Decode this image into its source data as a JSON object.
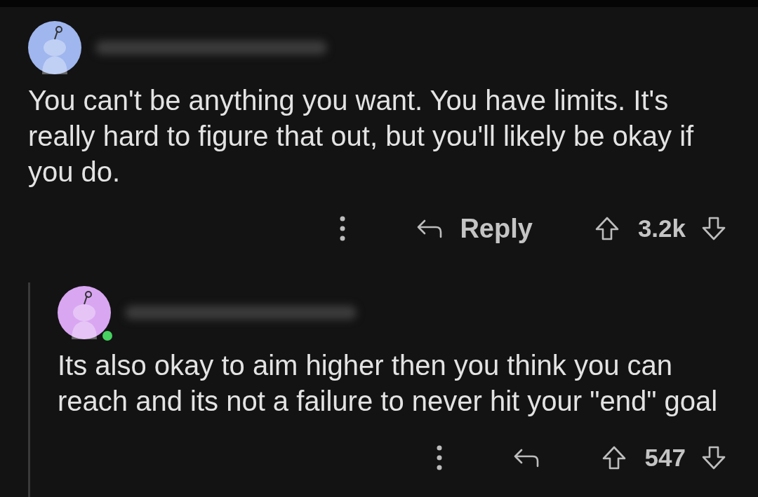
{
  "comments": [
    {
      "color": "#9fb6ee",
      "online": false,
      "text": "You can't be anything you want. You have limits. It's really hard to figure that out, but you'll likely be okay if you do.",
      "reply_label": "Reply",
      "score": "3.2k"
    },
    {
      "color": "#d9a6f2",
      "online": true,
      "text": "Its also okay to aim higher then you think you can reach and its not a failure to never hit your \"end\" goal",
      "score": "547"
    }
  ]
}
